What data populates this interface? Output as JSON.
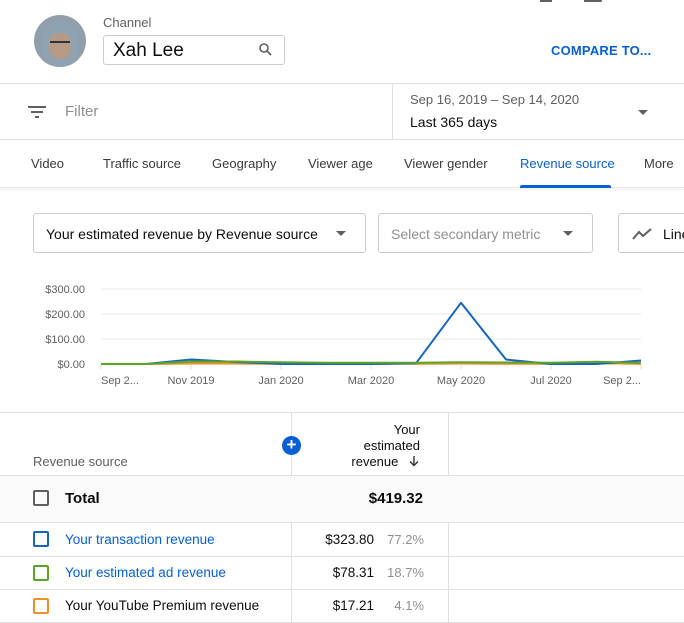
{
  "header": {
    "channel_label": "Channel",
    "channel_name": "Xah Lee",
    "compare_label": "COMPARE TO..."
  },
  "filter": {
    "placeholder": "Filter"
  },
  "date": {
    "range": "Sep 16, 2019 – Sep 14, 2020",
    "label": "Last 365 days"
  },
  "tabs": [
    {
      "label": "Video",
      "active": false
    },
    {
      "label": "Traffic source",
      "active": false
    },
    {
      "label": "Geography",
      "active": false
    },
    {
      "label": "Viewer age",
      "active": false
    },
    {
      "label": "Viewer gender",
      "active": false
    },
    {
      "label": "Revenue source",
      "active": true
    },
    {
      "label": "More",
      "active": false
    }
  ],
  "controls": {
    "primary_metric": "Your estimated revenue by Revenue source",
    "secondary_metric_placeholder": "Select secondary metric",
    "chart_type": "Line chart"
  },
  "colors": {
    "accent": "#065fd4",
    "transaction": "#1565c0",
    "ad": "#5ba524",
    "premium": "#ef8f2a"
  },
  "chart_data": {
    "type": "line",
    "title": "",
    "xlabel": "",
    "ylabel": "Your estimated revenue",
    "x": [
      "Sep 2019",
      "Oct 2019",
      "Nov 2019",
      "Dec 2019",
      "Jan 2020",
      "Feb 2020",
      "Mar 2020",
      "Apr 2020",
      "May 2020",
      "Jun 2020",
      "Jul 2020",
      "Aug 2020",
      "Sep 2020"
    ],
    "x_tick_labels": [
      "Sep 2...",
      "Nov 2019",
      "Jan 2020",
      "Mar 2020",
      "May 2020",
      "Jul 2020",
      "Sep 2..."
    ],
    "y_tick_labels": [
      "$0.00",
      "$100.00",
      "$200.00",
      "$300.00"
    ],
    "ylim": [
      0,
      300
    ],
    "grid": true,
    "series": [
      {
        "name": "Your transaction revenue",
        "color": "#1565c0",
        "values": [
          0,
          0,
          18,
          8,
          0,
          0,
          0,
          3,
          245,
          18,
          0,
          0,
          14
        ]
      },
      {
        "name": "Your estimated ad revenue",
        "color": "#5ba524",
        "values": [
          0,
          0,
          10,
          10,
          7,
          5,
          5,
          5,
          7,
          6,
          5,
          9,
          5
        ]
      },
      {
        "name": "Your YouTube Premium revenue",
        "color": "#ef8f2a",
        "values": [
          0,
          0,
          2,
          2,
          1,
          1,
          1,
          1,
          2,
          1,
          1,
          4,
          1
        ]
      }
    ]
  },
  "table": {
    "col_source": "Revenue source",
    "col_revenue_lines": [
      "Your",
      "estimated",
      "revenue"
    ],
    "sort_icon": "arrow-down-icon",
    "total": {
      "label": "Total",
      "value": "$419.32"
    },
    "rows": [
      {
        "label": "Your transaction revenue",
        "value": "$323.80",
        "pct": "77.2%",
        "color": "#1565c0",
        "link": true
      },
      {
        "label": "Your estimated ad revenue",
        "value": "$78.31",
        "pct": "18.7%",
        "color": "#5ba524",
        "link": true
      },
      {
        "label": "Your YouTube Premium revenue",
        "value": "$17.21",
        "pct": "4.1%",
        "color": "#ef8f2a",
        "link": false
      }
    ]
  }
}
